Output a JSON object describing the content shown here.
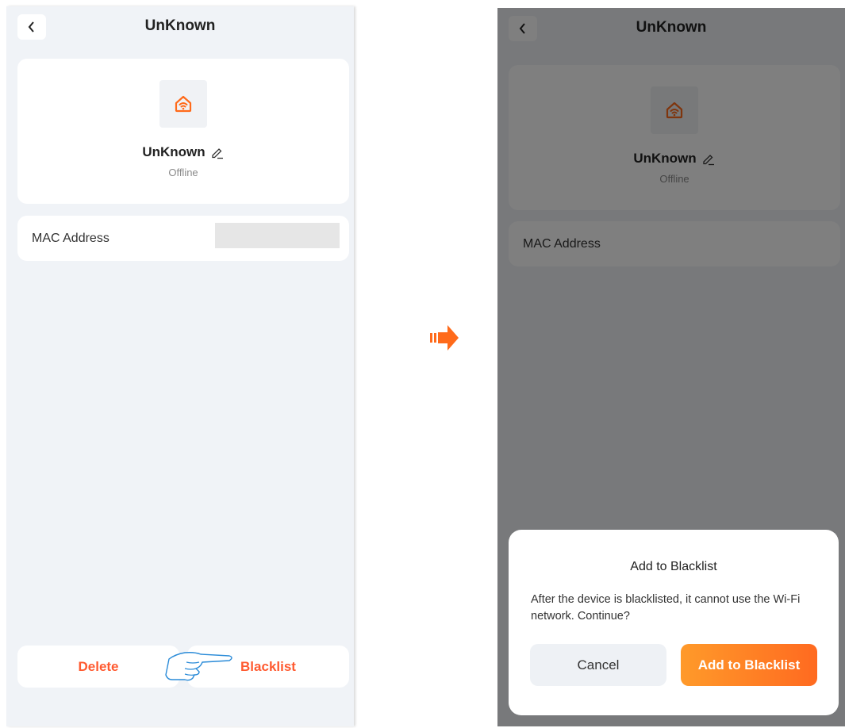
{
  "left_screen": {
    "header": {
      "title": "UnKnown"
    },
    "device": {
      "name": "UnKnown",
      "status": "Offline",
      "icon": "home-wifi-icon"
    },
    "info": {
      "mac_label": "MAC Address"
    },
    "actions": {
      "delete_label": "Delete",
      "blacklist_label": "Blacklist"
    }
  },
  "right_screen": {
    "header": {
      "title": "UnKnown"
    },
    "device": {
      "name": "UnKnown",
      "status": "Offline",
      "icon": "home-wifi-icon"
    },
    "info": {
      "mac_label": "MAC Address"
    },
    "dialog": {
      "title": "Add to Blacklist",
      "message": "After the device is blacklisted, it cannot use the Wi-Fi network. Continue?",
      "cancel_label": "Cancel",
      "confirm_label": "Add to Blacklist"
    }
  },
  "colors": {
    "accent": "#ff5a30",
    "confirm_gradient_start": "#ff9a2a",
    "confirm_gradient_end": "#ff6a20",
    "screen_background": "#f0f3f7",
    "hint_hand": "#2a8bd8"
  }
}
